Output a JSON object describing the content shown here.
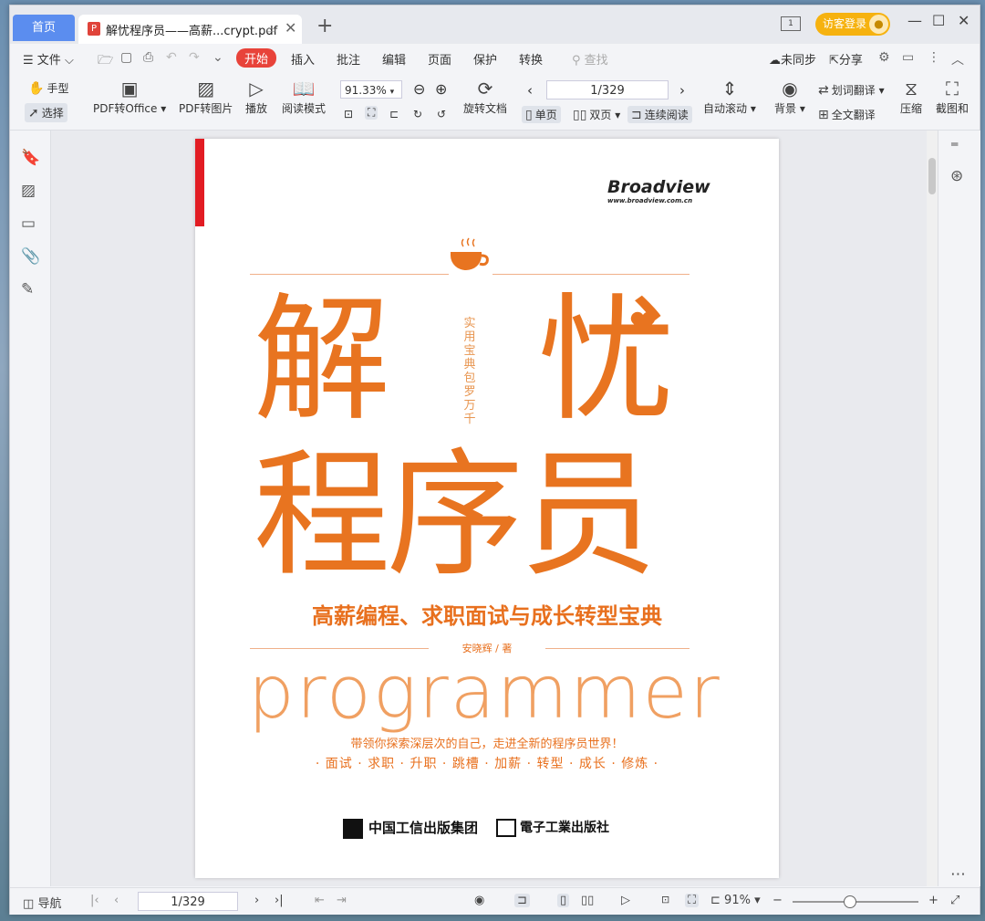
{
  "tabs": {
    "home": "首页",
    "document": "解忧程序员——高薪...crypt.pdf"
  },
  "window": {
    "login": "访客登录"
  },
  "menu": {
    "file": "文件",
    "start": "开始",
    "insert": "插入",
    "annotate": "批注",
    "edit": "编辑",
    "page": "页面",
    "protect": "保护",
    "convert": "转换",
    "search_placeholder": "查找",
    "sync": "未同步",
    "share": "分享"
  },
  "toolbar": {
    "hand": "手型",
    "select": "选择",
    "pdf_to_office": "PDF转Office",
    "pdf_to_image": "PDF转图片",
    "play": "播放",
    "read_mode": "阅读模式",
    "zoom": "91.33%",
    "rotate_doc": "旋转文档",
    "page_field": "1/329",
    "single_page": "单页",
    "double_page": "双页",
    "continuous": "连续阅读",
    "auto_scroll": "自动滚动",
    "background": "背景",
    "word_translate": "划词翻译",
    "full_translate": "全文翻译",
    "compress": "压缩",
    "screenshot": "截图和"
  },
  "book": {
    "publisher_brand": "Broadview",
    "publisher_url": "www.broadview.com.cn",
    "big_title_1": "解",
    "big_title_2": "忧",
    "big_title_3": "程序员",
    "vertical_text": "实用宝典 包罗万千",
    "subtitle": "高薪编程、求职面试与成长转型宝典",
    "author": "安晓辉 / 著",
    "english": "programmer",
    "tagline": "带领你探索深层次的自己，走进全新的程序员世界！",
    "keywords": "· 面试 · 求职 · 升职 · 跳槽 · 加薪 · 转型 · 成长 · 修炼 ·",
    "publisher_1": "中国工信出版集团",
    "publisher_2": "電子工業出版社"
  },
  "statusbar": {
    "nav": "导航",
    "page_field": "1/329",
    "zoom": "91%"
  },
  "colors": {
    "accent_red": "#e8433a",
    "book_orange": "#e87420",
    "tab_blue": "#5b8def",
    "login_gold": "#f6b20f"
  }
}
